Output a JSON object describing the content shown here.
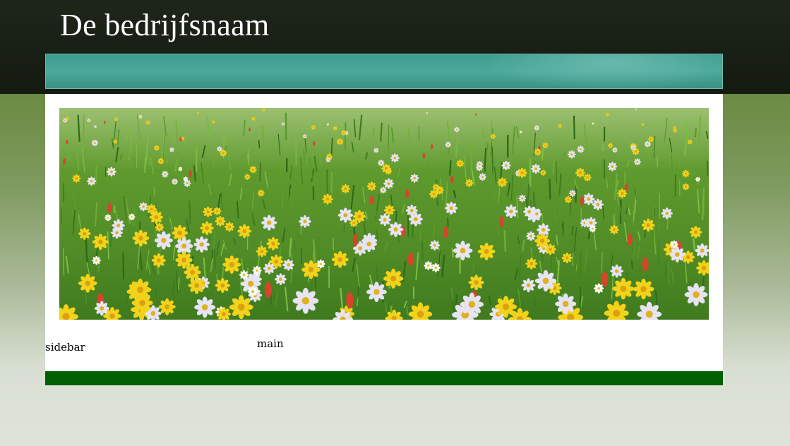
{
  "header": {
    "site_title": "De bedrijfsnaam"
  },
  "nav": {
    "items": []
  },
  "banner": {
    "image": "wildflower-meadow"
  },
  "layout": {
    "sidebar_label": "sidebar",
    "main_label": "main"
  },
  "colors": {
    "header_bg": "#1a2015",
    "nav_teal": "#45a396",
    "footer_green": "#006000",
    "page_green": "#6b8a42"
  }
}
